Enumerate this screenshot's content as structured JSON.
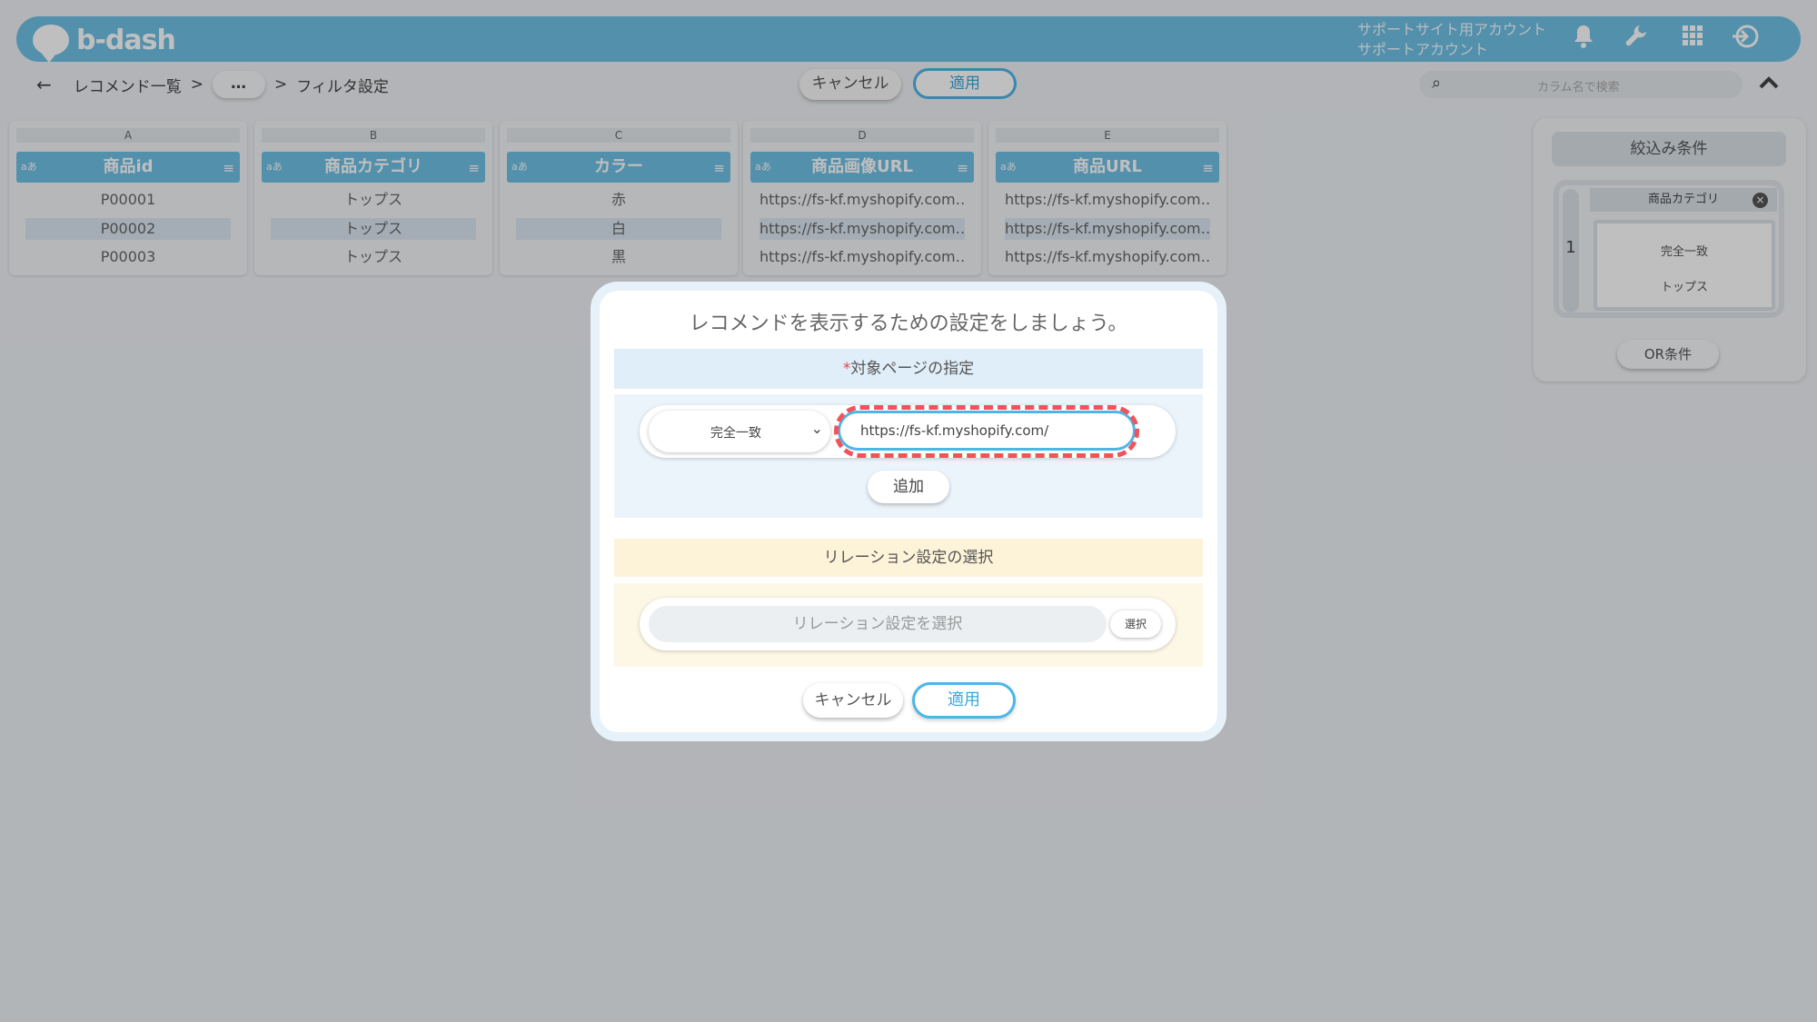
{
  "header": {
    "logo_text": "b-dash",
    "account_line1": "サポートサイト用アカウント",
    "account_line2": "サポートアカウント",
    "icons": [
      "bell-icon",
      "wrench-icon",
      "grid-icon",
      "logout-icon"
    ]
  },
  "nav": {
    "breadcrumb_root": "レコメンド一覧",
    "breadcrumb_more": "…",
    "breadcrumb_current": "フィルタ設定",
    "separator": ">",
    "cancel_label": "キャンセル",
    "apply_label": "適用",
    "search_placeholder": "カラム名で検索"
  },
  "columns": [
    {
      "letter": "A",
      "name": "商品id",
      "type": "aあ",
      "cells": [
        "P00001",
        "P00002",
        "P00003"
      ]
    },
    {
      "letter": "B",
      "name": "商品カテゴリ",
      "type": "aあ",
      "cells": [
        "トップス",
        "トップス",
        "トップス"
      ]
    },
    {
      "letter": "C",
      "name": "カラー",
      "type": "aあ",
      "cells": [
        "赤",
        "白",
        "黒"
      ]
    },
    {
      "letter": "D",
      "name": "商品画像URL",
      "type": "aあ",
      "cells": [
        "https://fs-kf.myshopify.com…",
        "https://fs-kf.myshopify.com…",
        "https://fs-kf.myshopify.com…"
      ]
    },
    {
      "letter": "E",
      "name": "商品URL",
      "type": "aあ",
      "cells": [
        "https://fs-kf.myshopify.com…",
        "https://fs-kf.myshopify.com…",
        "https://fs-kf.myshopify.com…"
      ]
    }
  ],
  "filter_panel": {
    "title": "絞込み条件",
    "group_number": "1",
    "condition_column": "商品カテゴリ",
    "condition_match": "完全一致",
    "condition_value": "トップス",
    "or_label": "OR条件"
  },
  "modal": {
    "title": "レコメンドを表示するための設定をしましょう。",
    "section1_required_mark": "*",
    "section1_title": "対象ページの指定",
    "match_select_value": "完全一致",
    "url_value": "https://fs-kf.myshopify.com/",
    "add_label": "追加",
    "section2_title": "リレーション設定の選択",
    "relation_placeholder": "リレーション設定を選択",
    "select_label": "選択",
    "cancel_label": "キャンセル",
    "apply_label": "適用"
  },
  "colors": {
    "accent": "#6fc0e6",
    "apply_border": "#4db6e8",
    "highlight": "#f0535c"
  }
}
